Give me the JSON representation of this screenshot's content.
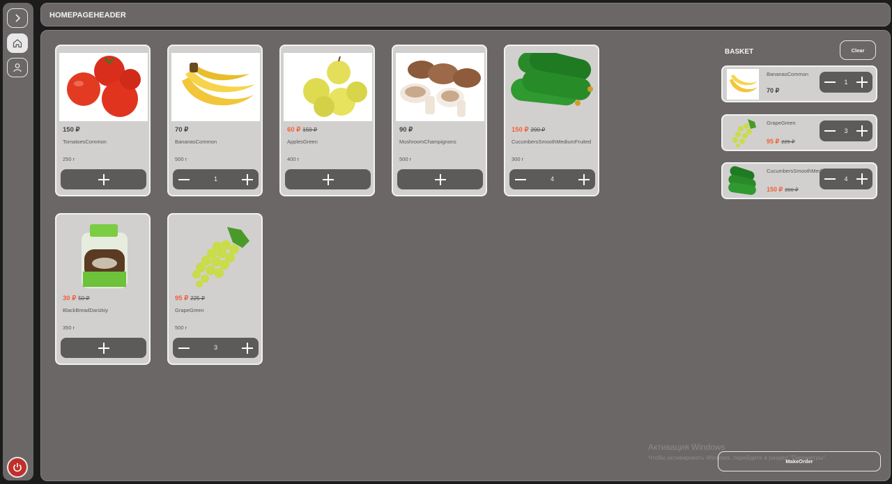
{
  "sidebar": {
    "icons": [
      "chevron-right-icon",
      "home-icon",
      "user-icon",
      "power-icon"
    ],
    "power_color": "#c0302b"
  },
  "header": {
    "title": "HOMEPAGEHEADER"
  },
  "products": [
    {
      "price": "150 ₽",
      "old_price": "",
      "on_sale": false,
      "name": "TomatoesCommon",
      "weight": "250 г",
      "quantity": ""
    },
    {
      "price": "70 ₽",
      "old_price": "",
      "on_sale": false,
      "name": "BananasCommon",
      "weight": "500 г",
      "quantity": "1"
    },
    {
      "price": "60 ₽",
      "old_price": "150 ₽",
      "on_sale": true,
      "name": "ApplesGreen",
      "weight": "400 г",
      "quantity": ""
    },
    {
      "price": "90 ₽",
      "old_price": "",
      "on_sale": false,
      "name": "MushroomChampignons",
      "weight": "500 г",
      "quantity": ""
    },
    {
      "price": "150 ₽",
      "old_price": "200 ₽",
      "on_sale": true,
      "name": "CucumbersSmoothMediumFruited",
      "weight": "300 г",
      "quantity": "4"
    },
    {
      "price": "30 ₽",
      "old_price": "50 ₽",
      "on_sale": true,
      "name": "BlackBreadDarizkiy",
      "weight": "350 г",
      "quantity": ""
    },
    {
      "price": "95 ₽",
      "old_price": "225 ₽",
      "on_sale": true,
      "name": "GrapeGreen",
      "weight": "500 г",
      "quantity": "3"
    }
  ],
  "basket": {
    "title": "BASKET",
    "clear_label": "Clear",
    "items": [
      {
        "name": "BananasCommon",
        "price": "70 ₽",
        "old_price": "",
        "quantity": "1"
      },
      {
        "name": "GrapeGreen",
        "price": "95 ₽",
        "old_price": "225 ₽",
        "quantity": "3"
      },
      {
        "name": "CucumbersSmoothMediumFrui...",
        "price": "150 ₽",
        "old_price": "200 ₽",
        "quantity": "4"
      }
    ],
    "make_order_label": "MakeOrder"
  },
  "watermark": {
    "title": "Активация Windows",
    "subtitle": "Чтобы активировать Windows, перейдите в раздел \"Параметры\"."
  },
  "colors": {
    "sale": "#f0623a",
    "panel": "#6a6766",
    "card": "#d2cfcf",
    "button": "#5d5a5a"
  }
}
